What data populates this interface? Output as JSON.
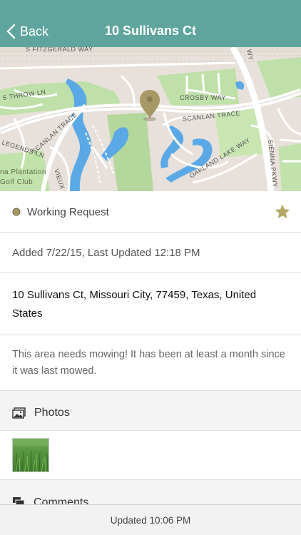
{
  "navbar": {
    "back_label": "Back",
    "title": "10 Sullivans Ct",
    "background": "#5fa59e"
  },
  "map": {
    "street_labels": {
      "fitzgerald": "S FITZGERALD WAY",
      "throw": "S THROW LN",
      "crosby": "CROSBY WAY",
      "scanlan_trace_right": "SCANLAN TRACE",
      "scanlan_trace_left": "SCANLAN TRACE",
      "legends": "LEGENDS LN",
      "vieux": "VIEUX CA",
      "oakland_lake": "OAKLAND LAKE WAY",
      "sienna": "SIENNA PKWY",
      "wy": "WY"
    },
    "poi_labels": {
      "plantation_1": "na Plantation",
      "plantation_2": "Golf Club"
    },
    "pin_color": "#a89866"
  },
  "request": {
    "status": "Working Request",
    "status_color": "#a89866",
    "star_color": "#b5a864",
    "dates": "Added 7/22/15, Last Updated 12:18 PM",
    "address": "10 Sullivans Ct, Missouri City, 77459, Texas, United States",
    "description": "This area needs mowing! It has been at least a month since it was last mowed."
  },
  "photos": {
    "label": "Photos",
    "icon": "photos-icon"
  },
  "comments": {
    "label": "Comments",
    "icon": "comments-icon"
  },
  "footer": {
    "text": "Updated 10:06 PM"
  }
}
